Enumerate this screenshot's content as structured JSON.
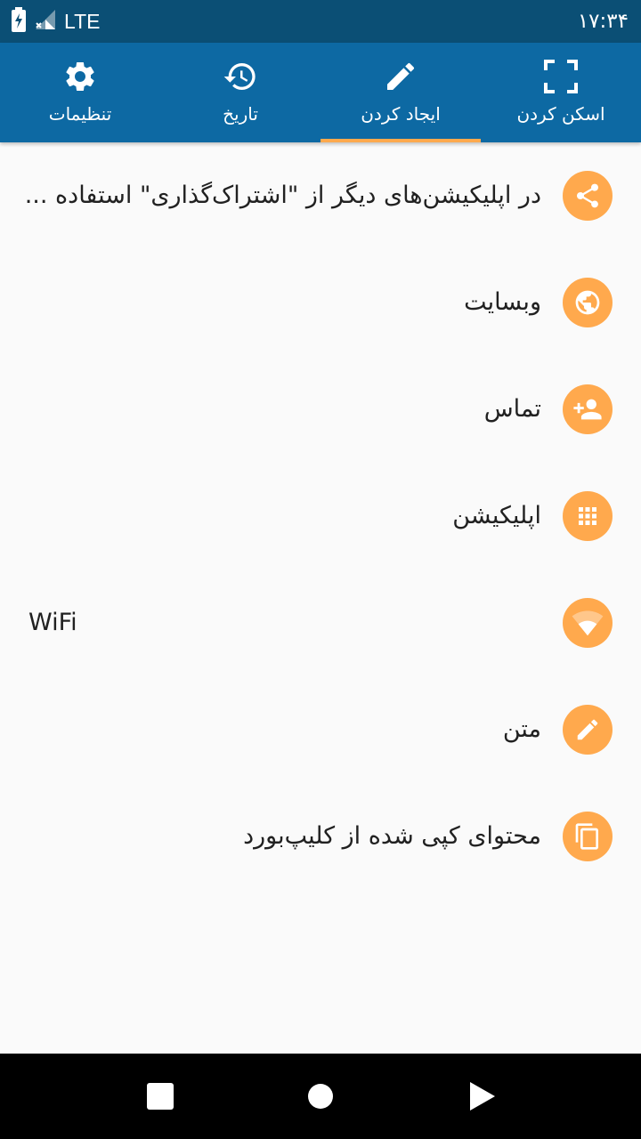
{
  "status_bar": {
    "network": "LTE",
    "time": "۱۷:۳۴",
    "icons": [
      "battery-charging-icon",
      "signal-icon"
    ]
  },
  "tabs": [
    {
      "label": "اسکن کردن",
      "icon": "scan-frame-icon"
    },
    {
      "label": "ایجاد کردن",
      "icon": "pencil-icon",
      "selected": true
    },
    {
      "label": "تاریخ",
      "icon": "history-icon"
    },
    {
      "label": "تنظیمات",
      "icon": "gear-icon"
    }
  ],
  "items": [
    {
      "label": "در اپلیکیشن‌های دیگر از \"اشتراک‌گذاری\" استفاده ...",
      "icon": "share-icon"
    },
    {
      "label": "وبسایت",
      "icon": "globe-icon"
    },
    {
      "label": "تماس",
      "icon": "add-contact-icon"
    },
    {
      "label": "اپلیکیشن",
      "icon": "apps-grid-icon"
    },
    {
      "label": "WiFi",
      "icon": "wifi-icon"
    },
    {
      "label": "متن",
      "icon": "pencil-icon"
    },
    {
      "label": "محتوای کپی شده از کلیپ‌بورد",
      "icon": "copy-icon"
    }
  ],
  "colors": {
    "status_bar": "#0b4f75",
    "app_bar": "#0d69a3",
    "accent": "#ffa94d",
    "background": "#fafafa",
    "nav_bar": "#000000"
  },
  "nav_bar": {
    "buttons": [
      "recents-square-icon",
      "home-circle-icon",
      "back-triangle-icon"
    ]
  }
}
